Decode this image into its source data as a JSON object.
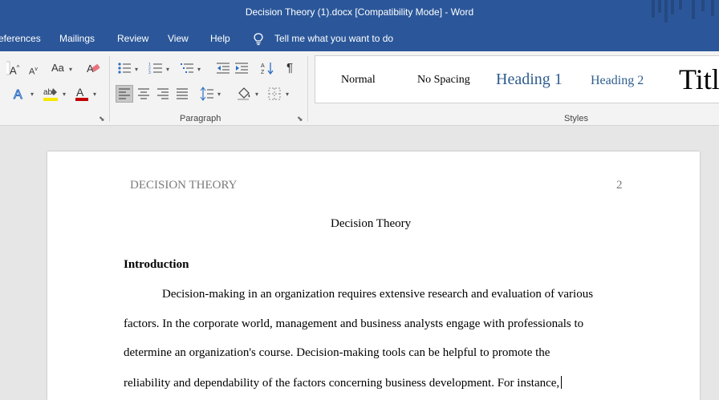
{
  "window": {
    "title": "Decision Theory (1).docx [Compatibility Mode]  -  Word"
  },
  "menu": {
    "tabs": [
      "eferences",
      "Mailings",
      "Review",
      "View",
      "Help"
    ],
    "tell_me": "Tell me what you want to do"
  },
  "ribbon": {
    "paragraph_label": "Paragraph",
    "styles_label": "Styles",
    "font_case_label": "Aa",
    "styles": [
      "Normal",
      "No Spacing",
      "Heading 1",
      "Heading 2",
      "Title"
    ]
  },
  "document": {
    "running_head": "DECISION THEORY",
    "page_number": "2",
    "title": "Decision Theory",
    "heading": "Introduction",
    "lines": [
      "Decision-making in an organization requires extensive research and evaluation of various",
      "factors. In the corporate world, management and business analysts engage with professionals to",
      "determine an organization's course. Decision-making tools can be helpful to promote the",
      "reliability and dependability of the factors concerning business development. For instance,"
    ]
  },
  "colors": {
    "accent": "#2b579a",
    "heading": "#2e5d8e",
    "ribbon_bg": "#f3f3f3",
    "canvas_bg": "#e6e6e6"
  }
}
